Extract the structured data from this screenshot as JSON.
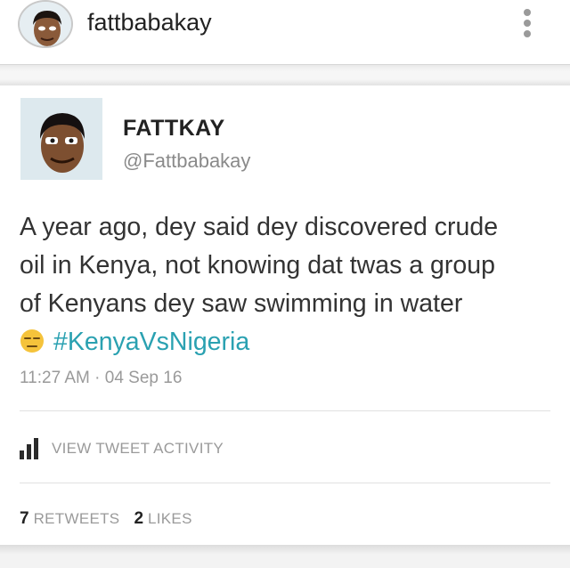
{
  "instagram": {
    "username": "fattbabakay",
    "avatar_icon": "cartoon-face-avatar",
    "more_icon": "vertical-ellipsis-icon"
  },
  "tweet": {
    "display_name": "FATTKAY",
    "handle": "@Fattbabakay",
    "text_lines": [
      "A year ago, dey said dey discovered crude",
      "oil in Kenya, not knowing dat twas a group",
      "of Kenyans dey saw swimming in water"
    ],
    "emoji": "unamused-face-emoji",
    "hashtag": "#KenyaVsNigeria",
    "timestamp": "11:27 AM · 04 Sep 16",
    "activity_label": "VIEW TWEET ACTIVITY",
    "retweets_count": "7",
    "retweets_label": "RETWEETS",
    "likes_count": "2",
    "likes_label": "LIKES",
    "colors": {
      "hashtag": "#2aa1b1",
      "muted": "#9a9a9a"
    }
  }
}
